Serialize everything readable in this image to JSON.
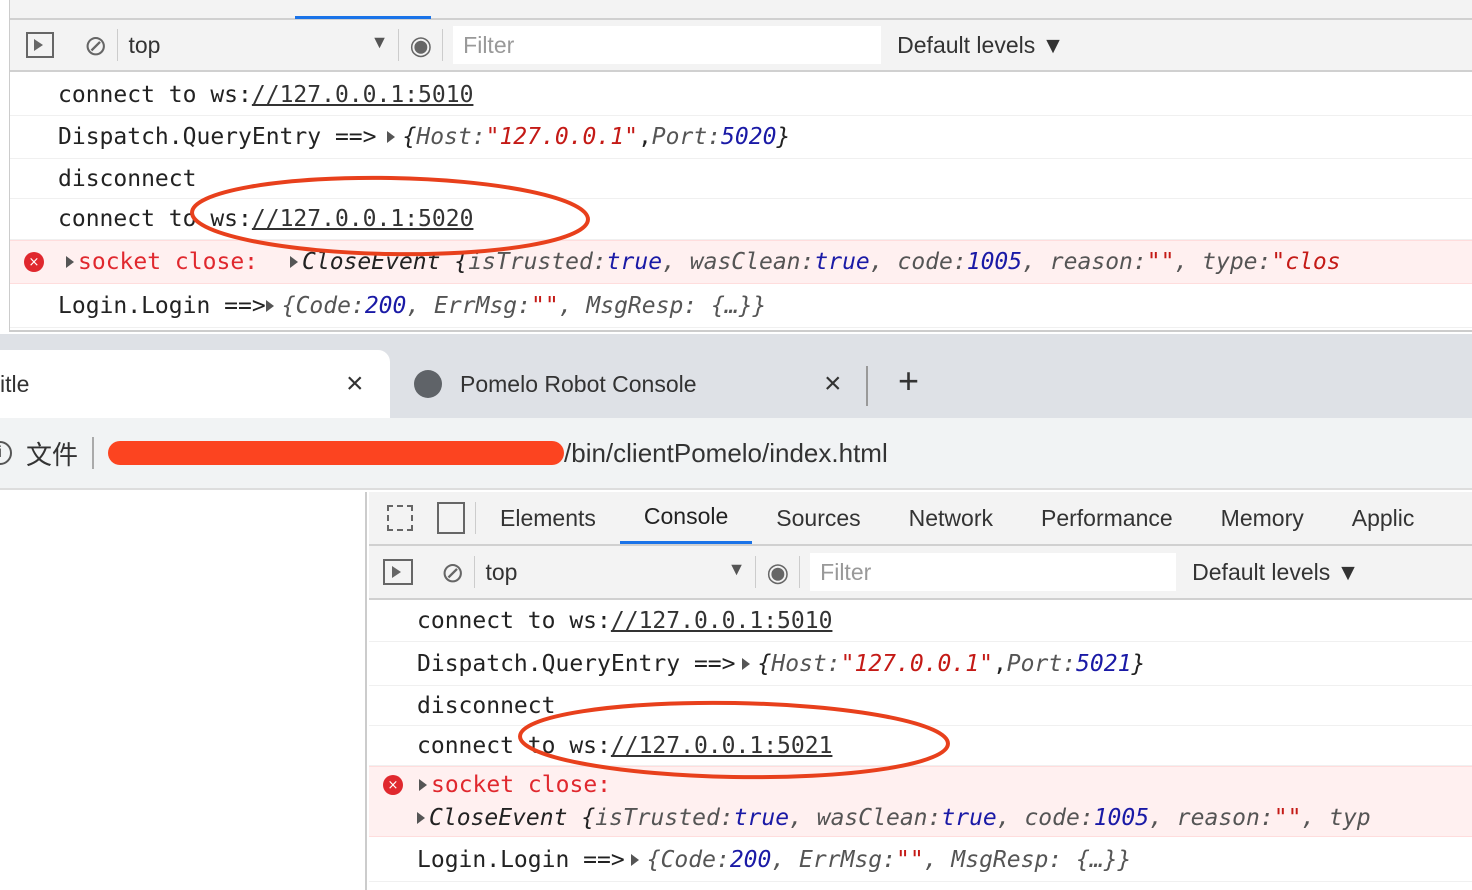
{
  "top_console": {
    "toolbar": {
      "context": "top",
      "filter_placeholder": "Filter",
      "levels": "Default levels ▼"
    },
    "rows": [
      {
        "prefix": "connect to ws:",
        "link": "//127.0.0.1:5010"
      },
      {
        "prefix": "Dispatch.QueryEntry ==> ",
        "obj": {
          "open": "{",
          "k1": "Host: ",
          "v1": "\"127.0.0.1\"",
          "sep": ", ",
          "k2": "Port: ",
          "v2": "5020",
          "close": "}"
        }
      },
      {
        "text": "disconnect"
      },
      {
        "prefix": "connect to ws:",
        "link": "//127.0.0.1:5020"
      },
      {
        "error": "socket close:",
        "event": "CloseEvent {",
        "isTrusted_k": "isTrusted: ",
        "isTrusted_v": "true",
        "wasClean_k": ", wasClean: ",
        "wasClean_v": "true",
        "code_k": ", code: ",
        "code_v": "1005",
        "reason_k": ", reason: ",
        "reason_v": "\"\"",
        "type_k": ", type: ",
        "type_v": "\"clos"
      },
      {
        "prefix": "Login.Login ==> ",
        "code_k": "{Code: ",
        "code_v": "200",
        "errmsg_k": ", ErrMsg: ",
        "errmsg_v": "\"\"",
        "rest": ", MsgResp: {…}}"
      }
    ]
  },
  "browser": {
    "tabs": [
      {
        "title": "itle",
        "close": "×"
      },
      {
        "title": "Pomelo Robot Console",
        "close": "×"
      }
    ],
    "new_tab": "+",
    "address": {
      "scheme_label": "文件",
      "url_visible": "/bin/clientPomelo/index.html"
    }
  },
  "devtools": {
    "tabs": [
      "Elements",
      "Console",
      "Sources",
      "Network",
      "Performance",
      "Memory",
      "Applic"
    ],
    "active_tab": "Console",
    "toolbar": {
      "context": "top",
      "filter_placeholder": "Filter",
      "levels": "Default levels ▼"
    },
    "rows": [
      {
        "prefix": "connect to ws:",
        "link": "//127.0.0.1:5010"
      },
      {
        "prefix": "Dispatch.QueryEntry ==> ",
        "obj": {
          "open": "{",
          "k1": "Host: ",
          "v1": "\"127.0.0.1\"",
          "sep": ", ",
          "k2": "Port: ",
          "v2": "5021",
          "close": "}"
        }
      },
      {
        "text": "disconnect"
      },
      {
        "prefix": "connect to ws:",
        "link": "//127.0.0.1:5021"
      },
      {
        "error": "socket close:",
        "event": "CloseEvent {",
        "isTrusted_k": "isTrusted: ",
        "isTrusted_v": "true",
        "wasClean_k": ", wasClean: ",
        "wasClean_v": "true",
        "code_k": ", code: ",
        "code_v": "1005",
        "reason_k": ", reason: ",
        "reason_v": "\"\"",
        "type_k": ", typ"
      },
      {
        "prefix": "Login.Login ==> ",
        "code_k": "{Code: ",
        "code_v": "200",
        "errmsg_k": ", ErrMsg: ",
        "errmsg_v": "\"\"",
        "rest": ", MsgResp: {…}}"
      }
    ]
  },
  "annotation_color": "#e8401c"
}
